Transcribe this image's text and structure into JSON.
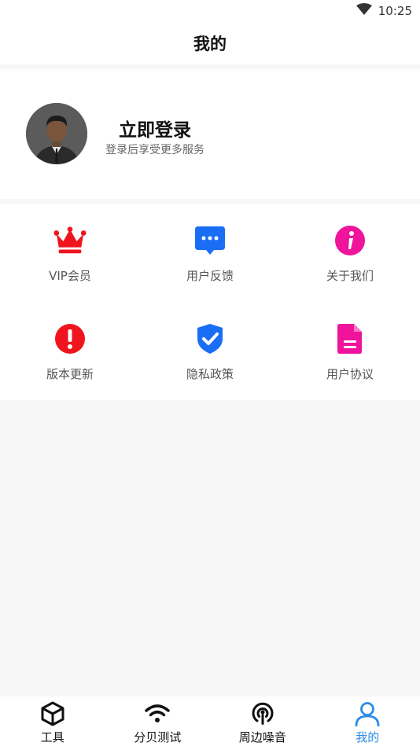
{
  "status_bar": {
    "time": "10:25",
    "wifi_icon": "wifi-signal-icon"
  },
  "header": {
    "title": "我的"
  },
  "profile": {
    "avatar_icon": "user-avatar",
    "login_title": "立即登录",
    "login_subtitle": "登录后享受更多服务"
  },
  "menu": {
    "items": [
      {
        "label": "VIP会员",
        "icon": "crown-icon",
        "color": "#f0141e"
      },
      {
        "label": "用户反馈",
        "icon": "chat-bubble-icon",
        "color": "#1a6ef5"
      },
      {
        "label": "关于我们",
        "icon": "info-icon",
        "color": "#f0139c"
      },
      {
        "label": "版本更新",
        "icon": "exclamation-icon",
        "color": "#f0141e"
      },
      {
        "label": "隐私政策",
        "icon": "shield-check-icon",
        "color": "#1a6ef5"
      },
      {
        "label": "用户协议",
        "icon": "document-icon",
        "color": "#f0139c"
      }
    ]
  },
  "tabbar": {
    "tabs": [
      {
        "label": "工具",
        "icon": "cube-icon"
      },
      {
        "label": "分贝测试",
        "icon": "wifi-icon"
      },
      {
        "label": "周边噪音",
        "icon": "broadcast-icon"
      },
      {
        "label": "我的",
        "icon": "person-icon",
        "active": true
      }
    ],
    "active_color": "#2b8be6"
  }
}
